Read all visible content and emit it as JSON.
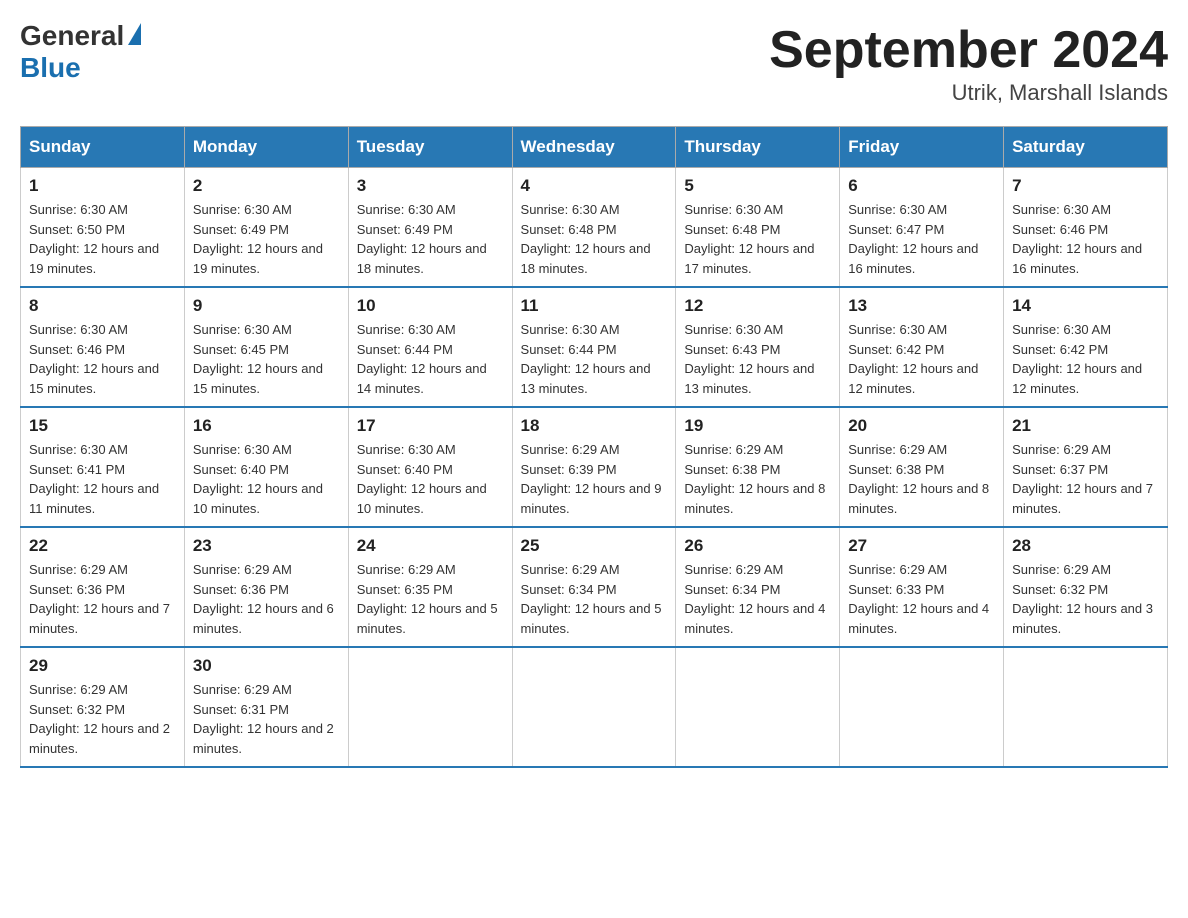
{
  "header": {
    "logo_general": "General",
    "logo_blue": "Blue",
    "title": "September 2024",
    "subtitle": "Utrik, Marshall Islands"
  },
  "days_of_week": [
    "Sunday",
    "Monday",
    "Tuesday",
    "Wednesday",
    "Thursday",
    "Friday",
    "Saturday"
  ],
  "weeks": [
    [
      {
        "day": "1",
        "sunrise": "Sunrise: 6:30 AM",
        "sunset": "Sunset: 6:50 PM",
        "daylight": "Daylight: 12 hours and 19 minutes."
      },
      {
        "day": "2",
        "sunrise": "Sunrise: 6:30 AM",
        "sunset": "Sunset: 6:49 PM",
        "daylight": "Daylight: 12 hours and 19 minutes."
      },
      {
        "day": "3",
        "sunrise": "Sunrise: 6:30 AM",
        "sunset": "Sunset: 6:49 PM",
        "daylight": "Daylight: 12 hours and 18 minutes."
      },
      {
        "day": "4",
        "sunrise": "Sunrise: 6:30 AM",
        "sunset": "Sunset: 6:48 PM",
        "daylight": "Daylight: 12 hours and 18 minutes."
      },
      {
        "day": "5",
        "sunrise": "Sunrise: 6:30 AM",
        "sunset": "Sunset: 6:48 PM",
        "daylight": "Daylight: 12 hours and 17 minutes."
      },
      {
        "day": "6",
        "sunrise": "Sunrise: 6:30 AM",
        "sunset": "Sunset: 6:47 PM",
        "daylight": "Daylight: 12 hours and 16 minutes."
      },
      {
        "day": "7",
        "sunrise": "Sunrise: 6:30 AM",
        "sunset": "Sunset: 6:46 PM",
        "daylight": "Daylight: 12 hours and 16 minutes."
      }
    ],
    [
      {
        "day": "8",
        "sunrise": "Sunrise: 6:30 AM",
        "sunset": "Sunset: 6:46 PM",
        "daylight": "Daylight: 12 hours and 15 minutes."
      },
      {
        "day": "9",
        "sunrise": "Sunrise: 6:30 AM",
        "sunset": "Sunset: 6:45 PM",
        "daylight": "Daylight: 12 hours and 15 minutes."
      },
      {
        "day": "10",
        "sunrise": "Sunrise: 6:30 AM",
        "sunset": "Sunset: 6:44 PM",
        "daylight": "Daylight: 12 hours and 14 minutes."
      },
      {
        "day": "11",
        "sunrise": "Sunrise: 6:30 AM",
        "sunset": "Sunset: 6:44 PM",
        "daylight": "Daylight: 12 hours and 13 minutes."
      },
      {
        "day": "12",
        "sunrise": "Sunrise: 6:30 AM",
        "sunset": "Sunset: 6:43 PM",
        "daylight": "Daylight: 12 hours and 13 minutes."
      },
      {
        "day": "13",
        "sunrise": "Sunrise: 6:30 AM",
        "sunset": "Sunset: 6:42 PM",
        "daylight": "Daylight: 12 hours and 12 minutes."
      },
      {
        "day": "14",
        "sunrise": "Sunrise: 6:30 AM",
        "sunset": "Sunset: 6:42 PM",
        "daylight": "Daylight: 12 hours and 12 minutes."
      }
    ],
    [
      {
        "day": "15",
        "sunrise": "Sunrise: 6:30 AM",
        "sunset": "Sunset: 6:41 PM",
        "daylight": "Daylight: 12 hours and 11 minutes."
      },
      {
        "day": "16",
        "sunrise": "Sunrise: 6:30 AM",
        "sunset": "Sunset: 6:40 PM",
        "daylight": "Daylight: 12 hours and 10 minutes."
      },
      {
        "day": "17",
        "sunrise": "Sunrise: 6:30 AM",
        "sunset": "Sunset: 6:40 PM",
        "daylight": "Daylight: 12 hours and 10 minutes."
      },
      {
        "day": "18",
        "sunrise": "Sunrise: 6:29 AM",
        "sunset": "Sunset: 6:39 PM",
        "daylight": "Daylight: 12 hours and 9 minutes."
      },
      {
        "day": "19",
        "sunrise": "Sunrise: 6:29 AM",
        "sunset": "Sunset: 6:38 PM",
        "daylight": "Daylight: 12 hours and 8 minutes."
      },
      {
        "day": "20",
        "sunrise": "Sunrise: 6:29 AM",
        "sunset": "Sunset: 6:38 PM",
        "daylight": "Daylight: 12 hours and 8 minutes."
      },
      {
        "day": "21",
        "sunrise": "Sunrise: 6:29 AM",
        "sunset": "Sunset: 6:37 PM",
        "daylight": "Daylight: 12 hours and 7 minutes."
      }
    ],
    [
      {
        "day": "22",
        "sunrise": "Sunrise: 6:29 AM",
        "sunset": "Sunset: 6:36 PM",
        "daylight": "Daylight: 12 hours and 7 minutes."
      },
      {
        "day": "23",
        "sunrise": "Sunrise: 6:29 AM",
        "sunset": "Sunset: 6:36 PM",
        "daylight": "Daylight: 12 hours and 6 minutes."
      },
      {
        "day": "24",
        "sunrise": "Sunrise: 6:29 AM",
        "sunset": "Sunset: 6:35 PM",
        "daylight": "Daylight: 12 hours and 5 minutes."
      },
      {
        "day": "25",
        "sunrise": "Sunrise: 6:29 AM",
        "sunset": "Sunset: 6:34 PM",
        "daylight": "Daylight: 12 hours and 5 minutes."
      },
      {
        "day": "26",
        "sunrise": "Sunrise: 6:29 AM",
        "sunset": "Sunset: 6:34 PM",
        "daylight": "Daylight: 12 hours and 4 minutes."
      },
      {
        "day": "27",
        "sunrise": "Sunrise: 6:29 AM",
        "sunset": "Sunset: 6:33 PM",
        "daylight": "Daylight: 12 hours and 4 minutes."
      },
      {
        "day": "28",
        "sunrise": "Sunrise: 6:29 AM",
        "sunset": "Sunset: 6:32 PM",
        "daylight": "Daylight: 12 hours and 3 minutes."
      }
    ],
    [
      {
        "day": "29",
        "sunrise": "Sunrise: 6:29 AM",
        "sunset": "Sunset: 6:32 PM",
        "daylight": "Daylight: 12 hours and 2 minutes."
      },
      {
        "day": "30",
        "sunrise": "Sunrise: 6:29 AM",
        "sunset": "Sunset: 6:31 PM",
        "daylight": "Daylight: 12 hours and 2 minutes."
      },
      null,
      null,
      null,
      null,
      null
    ]
  ]
}
